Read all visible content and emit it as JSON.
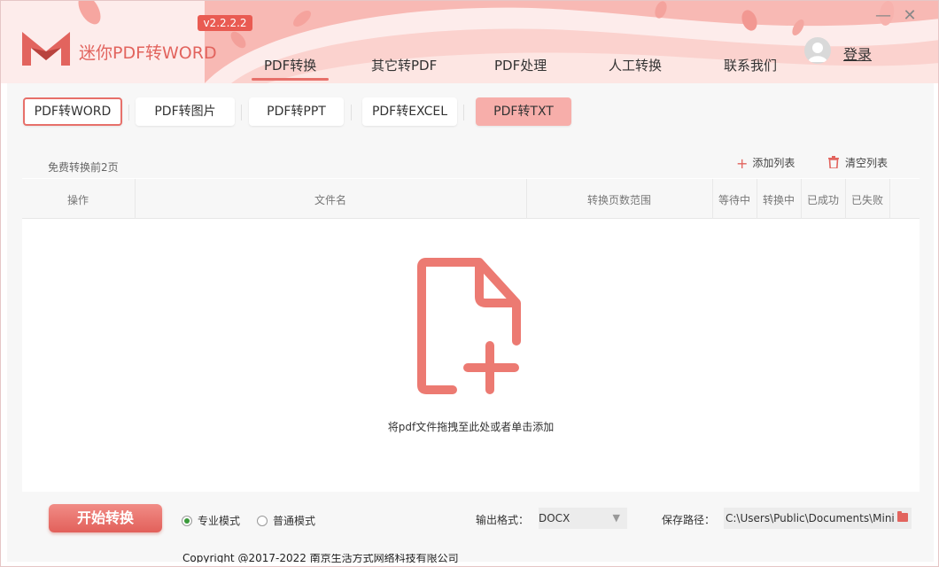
{
  "app": {
    "title": "迷你PDF转WORD",
    "version": "v2.2.2.2",
    "login_label": "登录",
    "accent_color": "#e7706a"
  },
  "nav": {
    "tabs": [
      {
        "label": "PDF转换",
        "active": true
      },
      {
        "label": "其它转PDF",
        "active": false
      },
      {
        "label": "PDF处理",
        "active": false
      },
      {
        "label": "人工转换",
        "active": false
      },
      {
        "label": "联系我们",
        "active": false
      }
    ]
  },
  "window_controls": {
    "minimize": "—",
    "close": "✕"
  },
  "convert_types": [
    {
      "label": "PDF转WORD",
      "selected": true
    },
    {
      "label": "PDF转图片",
      "selected": false
    },
    {
      "label": "PDF转PPT",
      "selected": false
    },
    {
      "label": "PDF转EXCEL",
      "selected": false
    },
    {
      "label": "PDF转TXT",
      "selected": false
    }
  ],
  "toolbar": {
    "free_note": "免费转换前2页",
    "add_list": "添加列表",
    "clear_list": "清空列表"
  },
  "table": {
    "columns": [
      "操作",
      "文件名",
      "转换页数范围",
      "等待中",
      "转换中",
      "已成功",
      "已失败"
    ]
  },
  "drop_zone": {
    "hint": "将pdf文件拖拽至此处或者单击添加",
    "icon": "add-file-icon"
  },
  "bottom": {
    "start_label": "开始转换",
    "modes": [
      {
        "label": "专业模式",
        "checked": true
      },
      {
        "label": "普通模式",
        "checked": false
      }
    ],
    "output_format_label": "输出格式：",
    "output_format_value": "DOCX",
    "save_path_label": "保存路径：",
    "save_path_value": "C:\\Users\\Public\\Documents\\Mini"
  },
  "footer": {
    "copyright": "Copyright @2017-2022 南京生活方式网络科技有限公司"
  }
}
